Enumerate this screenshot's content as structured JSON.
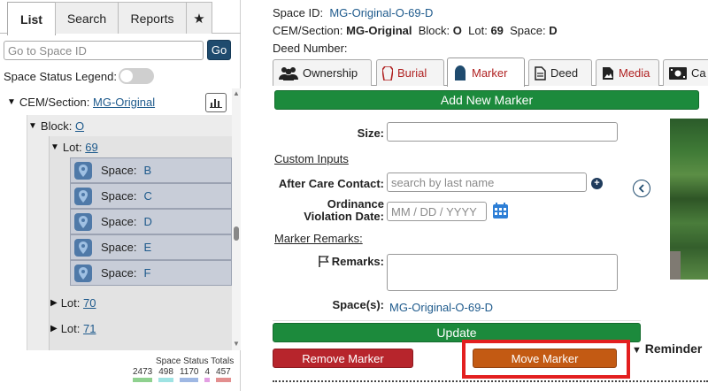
{
  "left": {
    "tabs": [
      {
        "label": "List",
        "active": true
      },
      {
        "label": "Search",
        "active": false
      },
      {
        "label": "Reports",
        "active": false
      },
      {
        "label": "★",
        "active": false
      }
    ],
    "search": {
      "placeholder": "Go to Space ID",
      "go_label": "Go"
    },
    "legend_label": "Space Status Legend:",
    "tree": {
      "cem_label": "CEM/Section:",
      "cem_value": "MG-Original",
      "block_label": "Block:",
      "block_value": "O",
      "lot_label": "Lot:",
      "lots": [
        {
          "value": "69",
          "expanded": true
        },
        {
          "value": "70",
          "expanded": false
        },
        {
          "value": "71",
          "expanded": false
        }
      ],
      "space_label": "Space:",
      "spaces": [
        "B",
        "C",
        "D",
        "E",
        "F"
      ]
    },
    "totals": {
      "label": "Space Status Totals",
      "items": [
        {
          "value": "2473",
          "color": "#8fd18f"
        },
        {
          "value": "498",
          "color": "#9fe3e3"
        },
        {
          "value": "1170",
          "color": "#9fb8e3"
        },
        {
          "value": "4",
          "color": "#e39fe3"
        },
        {
          "value": "457",
          "color": "#e38f8f"
        }
      ]
    }
  },
  "right": {
    "space_id_label": "Space ID:",
    "space_id_value": "MG-Original-O-69-D",
    "location": {
      "cem_label": "CEM/Section:",
      "cem_value": "MG-Original",
      "block_label": "Block:",
      "block_value": "O",
      "lot_label": "Lot:",
      "lot_value": "69",
      "space_label": "Space:",
      "space_value": "D"
    },
    "deed_label": "Deed Number:",
    "tabs": [
      {
        "label": "Ownership",
        "icon": "users-icon",
        "active": false
      },
      {
        "label": "Burial",
        "icon": "coffin-icon",
        "active": false
      },
      {
        "label": "Marker",
        "icon": "marker-icon",
        "active": true
      },
      {
        "label": "Deed",
        "icon": "document-icon",
        "active": false
      },
      {
        "label": "Media",
        "icon": "image-icon",
        "active": false
      },
      {
        "label": "Ca",
        "icon": "cash-icon",
        "active": false
      }
    ],
    "add_marker_label": "Add New Marker",
    "form": {
      "size_label": "Size:",
      "custom_inputs_label": "Custom Inputs",
      "after_care_label": "After Care Contact:",
      "after_care_placeholder": "search by last name",
      "ordinance_label_1": "Ordinance",
      "ordinance_label_2": "Violation Date:",
      "date_mm": "MM",
      "date_dd": "DD",
      "date_yyyy": "YYYY",
      "marker_remarks_label": "Marker Remarks:",
      "remarks_label": "Remarks:",
      "spaces_label": "Space(s):",
      "spaces_value": "MG-Original-O-69-D"
    },
    "update_label": "Update",
    "remove_label": "Remove Marker",
    "move_label": "Move Marker",
    "reminder_label": "Reminder"
  },
  "colors": {
    "green": "#1c8a3c",
    "red": "#b7252c",
    "orange": "#c35a13",
    "navy": "#1f4b6e",
    "link": "#1e5a8c",
    "highlight": "#e31f1f"
  }
}
